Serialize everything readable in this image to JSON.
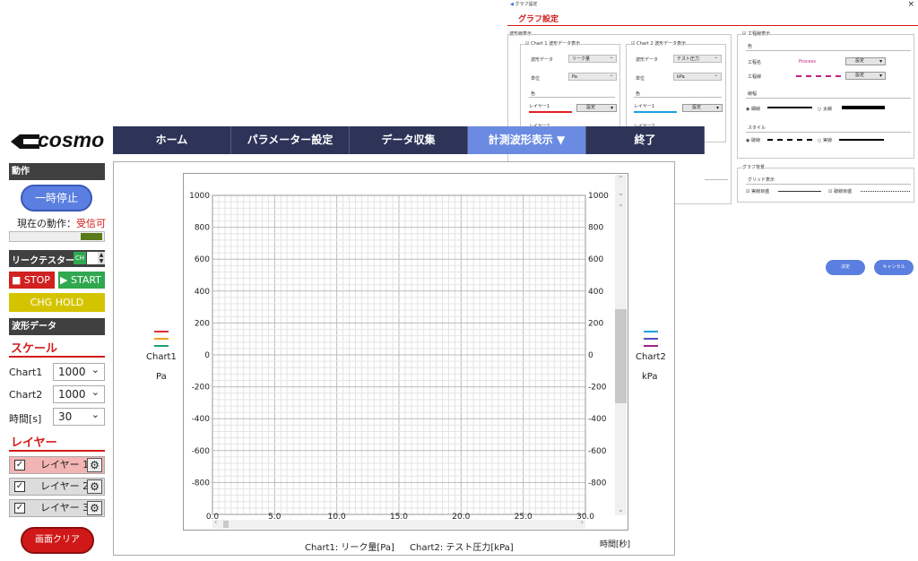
{
  "dialog": {
    "titlebar": "グラフ設定",
    "close": "×",
    "heading": "グラフ設定",
    "waveform_section": "波形線表示",
    "chart1": {
      "check_label": "Chart 1 波形データ表示",
      "data_label": "波形データ",
      "data_value": "リーク量",
      "unit_label": "単位",
      "unit_value": "Pa",
      "color_label": "色",
      "layer1": "レイヤー1",
      "layer2": "レイヤー2",
      "set_btn": "設定"
    },
    "chart2": {
      "check_label": "Chart 2 波形データ表示",
      "data_label": "波形データ",
      "data_value": "テスト圧力",
      "unit_label": "単位",
      "unit_value": "kPa",
      "color_label": "色",
      "layer1": "レイヤー1",
      "layer2": "レイヤー2",
      "set_btn": "設定"
    },
    "process": {
      "check_label": "工程線表示",
      "color_label": "色",
      "name_label": "工程名",
      "name_value": "Process",
      "set_btn": "設定",
      "line_label": "工程線",
      "width_label": "線幅",
      "thin": "細線",
      "thick": "太線",
      "style_label": "スタイル",
      "dashed": "破線",
      "solid": "実線"
    },
    "bg": {
      "section": "グラフ背景",
      "grid_label": "グリッド表示",
      "major": "実線目盛",
      "minor": "破線目盛"
    },
    "ok": "決定",
    "cancel": "キャンセル"
  },
  "logo": "cosmo",
  "nav": {
    "tabs": [
      "ホーム",
      "パラメーター設定",
      "データ収集",
      "計測波形表示 ▼",
      "終了"
    ]
  },
  "left": {
    "action_header": "動作",
    "pause_btn": "一時停止",
    "status_label": "現在の動作：",
    "status_value": "受信可",
    "leak_tester": "リークテスター",
    "ch_label": "CH",
    "stop_btn": "STOP",
    "start_btn": "START",
    "chg_hold": "CHG HOLD",
    "waveform_header": "波形データ",
    "scale_header": "スケール",
    "chart1_label": "Chart1",
    "chart1_value": "1000",
    "chart2_label": "Chart2",
    "chart2_value": "1000",
    "time_label": "時間[s]",
    "time_value": "30",
    "layer_header": "レイヤー",
    "layers": [
      "レイヤー 1",
      "レイヤー 2",
      "レイヤー 3"
    ],
    "clear_btn": "画面クリア"
  },
  "colors": {
    "accent": "#d31a1a",
    "nav": "#2d3458",
    "nav_active": "#6b8be2",
    "green": "#2fa84f",
    "yellow": "#d4c400"
  },
  "chart_data": {
    "type": "line",
    "left_axis": {
      "label": "Chart1",
      "unit": "Pa",
      "ticks": [
        1000,
        800,
        600,
        400,
        200,
        0,
        -200,
        -400,
        -600,
        -800
      ],
      "ylim": [
        -1000,
        1000
      ]
    },
    "right_axis": {
      "label": "Chart2",
      "unit": "kPa",
      "ticks": [
        1000,
        800,
        600,
        400,
        200,
        0,
        -200,
        -400,
        -600,
        -800
      ],
      "ylim": [
        -1000,
        1000
      ]
    },
    "x_ticks": [
      "0.0",
      "5.0",
      "10.0",
      "15.0",
      "20.0",
      "25.0",
      "30.0"
    ],
    "xlim": [
      0,
      30
    ],
    "xlabel": "時間[秒]",
    "caption_chart1": "Chart1: リーク量[Pa]",
    "caption_chart2": "Chart2: テスト圧力[kPa]",
    "legend_left_colors": [
      "#e03030",
      "#f0a020",
      "#20a070"
    ],
    "legend_right_colors": [
      "#1aa0e0",
      "#5050c0",
      "#a02080"
    ],
    "grid": true,
    "series": []
  }
}
